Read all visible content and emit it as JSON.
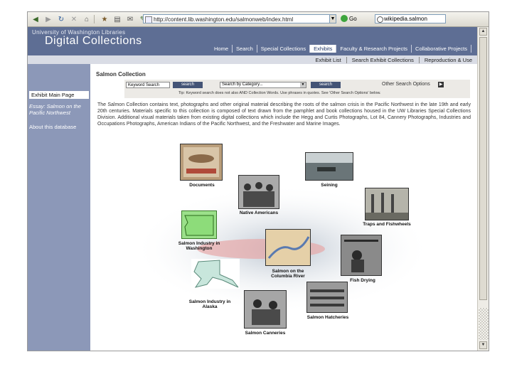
{
  "browser": {
    "address": "http://content.lib.washington.edu/salmonweb/index.html",
    "go_label": "Go",
    "search_text": "wikipedia.salmon"
  },
  "site": {
    "university": "University of Washington Libraries",
    "title": "Digital Collections",
    "nav": [
      "Home",
      "Search",
      "Special Collections",
      "Exhibits",
      "Faculty & Research Projects",
      "Collaborative Projects"
    ],
    "nav_active": "Exhibits",
    "subnav": [
      "Exhibit List",
      "Search Exhibit Collections",
      "Reproduction & Use"
    ]
  },
  "sidebar": {
    "items": [
      {
        "label": "Exhibit Main Page",
        "selected": true
      },
      {
        "label": "Essay: Salmon on the Pacific Northwest",
        "italic": true
      },
      {
        "label": "About this database"
      }
    ]
  },
  "content": {
    "title": "Salmon Collection",
    "keyword_placeholder": "Keyword Search",
    "search_btn": "search",
    "category_placeholder": "Search by Category...",
    "other_options": "Other Search Options",
    "hint": "Tip: Keyword search does not also AND Collection Words. Use phrases in quotes. See 'Other Search Options' below.",
    "description": "The Salmon Collection contains text, photographs and other original material describing the roots of the salmon crisis in the Pacific Northwest in the late 19th and early 20th centuries. Materials specific to this collection is composed of text drawn from the pamphlet and book collections housed in the UW Libraries Special Collections Division. Additional visual materials taken from existing digital collections which include the Hegg and Curtis Photographs, Lot 84, Cannery Photographs, Industries and Occupations Photographs, American Indians of the Pacific Northwest, and the Freshwater and Marine Images."
  },
  "collage": {
    "labels": [
      "Documents",
      "Seining",
      "Native Americans",
      "Traps and Fishwheels",
      "Salmon Industry in Washington",
      "Salmon on the Columbia River",
      "Fish Drying",
      "Salmon Industry in Alaska",
      "Salmon Hatcheries",
      "Salmon Canneries"
    ]
  }
}
